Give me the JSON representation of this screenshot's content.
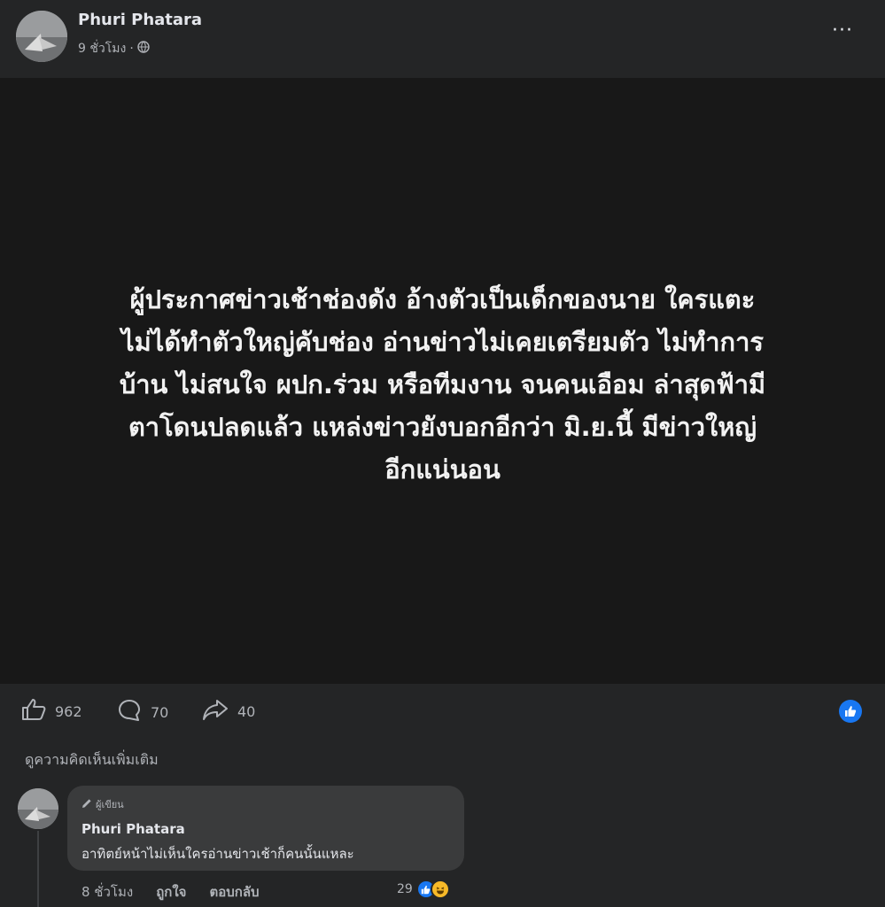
{
  "post": {
    "author": "Phuri Phatara",
    "time": "9 ชั่วโมง",
    "separator": "·",
    "privacy_icon": "globe-icon",
    "more_label": "···",
    "text_lines": [
      "ผู้ประกาศข่าวเช้าช่องดัง อ้างตัวเป็นเด็กของนาย ใครแตะ",
      "ไม่ได้ทำตัวใหญ่คับช่อง อ่านข่าวไม่เคยเตรียมตัว ไม่ทำการ",
      "บ้าน ไม่สนใจ ผปก.ร่วม หรือทีมงาน จนคนเอือม ล่าสุดฟ้ามี",
      "ตาโดนปลดแล้ว แหล่งข่าวยังบอกอีกว่า มิ.ย.นี้ มีข่าวใหญ่",
      "อีกแน่นอน"
    ],
    "background_color": "#181818"
  },
  "actions": {
    "likes": "962",
    "comments": "70",
    "shares": "40"
  },
  "comments_section": {
    "view_more": "ดูความคิดเห็นเพิ่มเติม",
    "comment": {
      "badge": "ผู้เขียน",
      "author": "Phuri Phatara",
      "text": "อาทิตย์หน้าไม่เห็นใครอ่านข่าวเช้าก็คนนั้นแหละ",
      "time": "8 ชั่วโมง",
      "like_label": "ถูกใจ",
      "reply_label": "ตอบกลับ",
      "reaction_count": "29"
    }
  },
  "colors": {
    "background": "#242526",
    "accent": "#1877f2"
  }
}
